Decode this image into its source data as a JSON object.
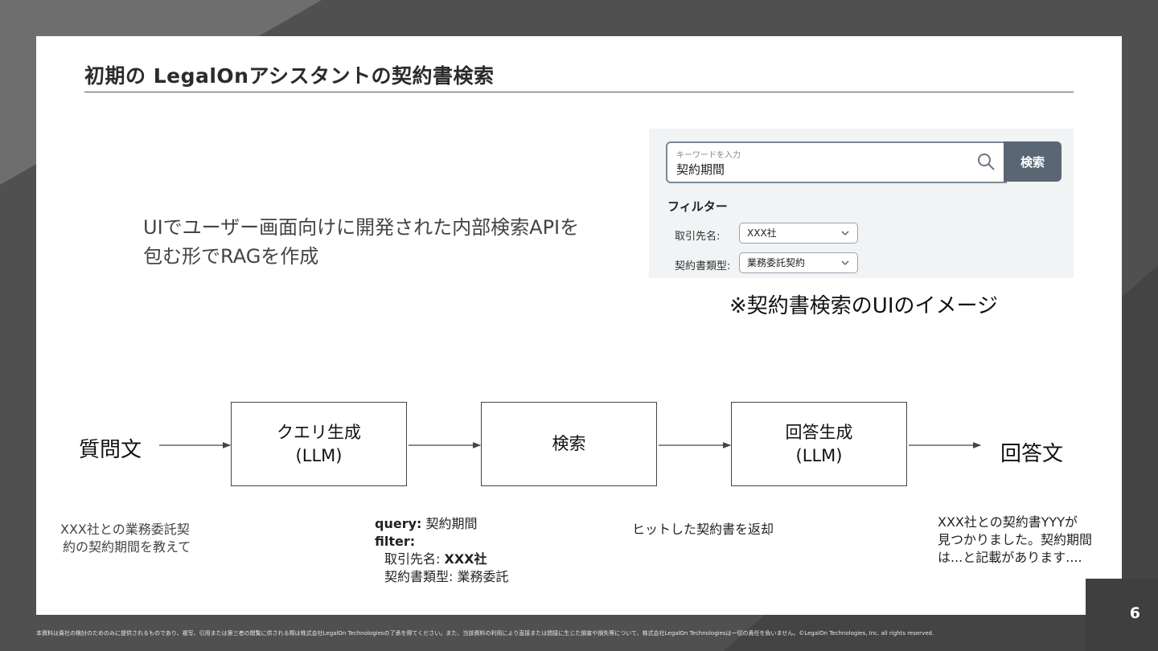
{
  "slide": {
    "title": "初期の LegalOnアシスタントの契約書検索",
    "description": "UIでユーザー画面向けに開発された内部検索APIを\n包む形でRAGを作成",
    "page_number": "6",
    "footer": "本資料は貴社の検討のためのみに提供されるものであり、複写、引用または第三者の閲覧に供される際は株式会社LegalOn Technologiesの了承を得てください。また、当該資料の利用により直接または間接に生じた損害や損失等について、株式会社LegalOn Technologiesは一切の責任を負いません。©LegalOn Technologies, Inc. all rights reserved."
  },
  "mock_ui": {
    "search_placeholder": "キーワードを入力",
    "search_value": "契約期間",
    "search_button": "検索",
    "filter_title": "フィルター",
    "filters": [
      {
        "label": "取引先名:",
        "value": "XXX社"
      },
      {
        "label": "契約書類型:",
        "value": "業務委託契約"
      }
    ],
    "caption": "※契約書検索のUIのイメージ"
  },
  "flow": {
    "input": "質問文",
    "output": "回答文",
    "steps": [
      {
        "line1": "クエリ生成",
        "line2": "(LLM)"
      },
      {
        "line1": "検索",
        "line2": ""
      },
      {
        "line1": "回答生成",
        "line2": "(LLM)"
      }
    ]
  },
  "notes": {
    "question": {
      "line1": "XXX社との業務委託契",
      "line2": "約の契約期間を教えて"
    },
    "query": {
      "query_key": "query:",
      "query_value": "契約期間",
      "filter_key": "filter:",
      "filter1_label": "取引先名:",
      "filter1_value": "XXX社",
      "filter2_label": "契約書類型:",
      "filter2_value": "業務委託"
    },
    "search_result": "ヒットした契約書を返却",
    "answer": {
      "line1": "XXX社との契約書YYYが",
      "line2": "見つかりました。契約期間",
      "line3": "は...と記載があります...."
    }
  }
}
